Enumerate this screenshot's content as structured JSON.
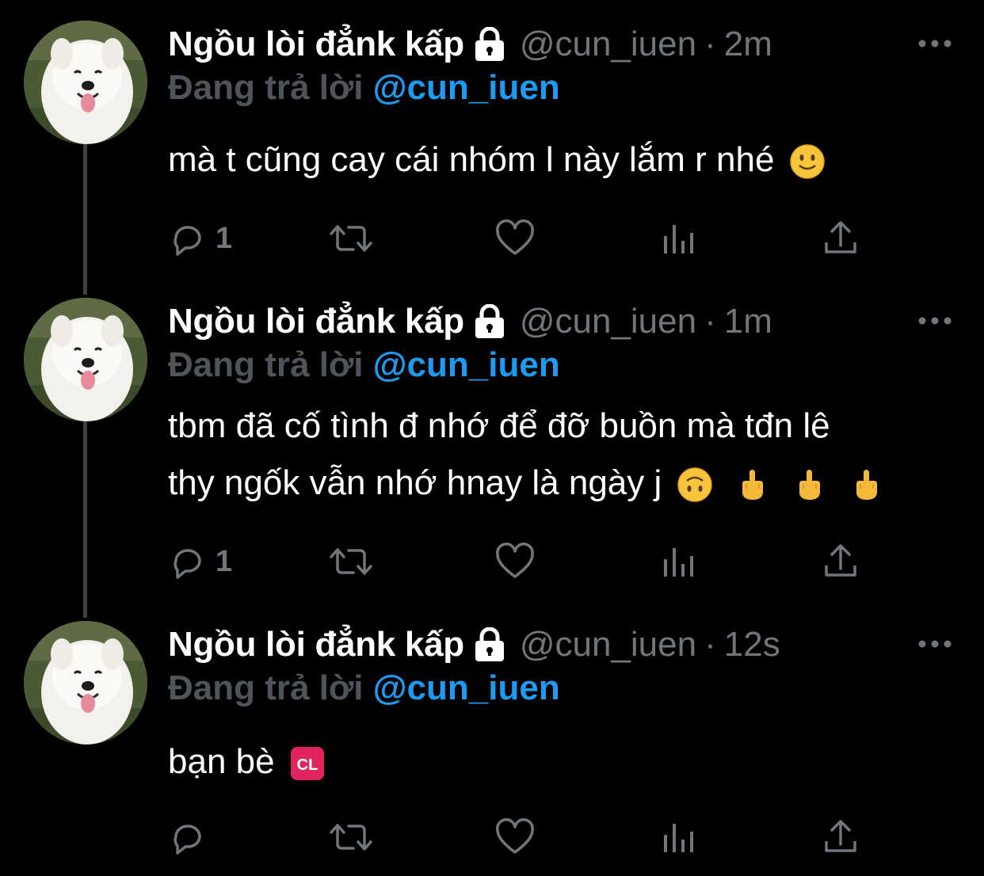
{
  "tweets": [
    {
      "name": "Ngồu lòi đẳnk kấp",
      "handle": "@cun_iuen",
      "separator": "·",
      "time": "2m",
      "reply_prefix": "Đang trả lời",
      "reply_mention": "@cun_iuen",
      "lines": [
        "mà t cũng cay cái nhóm l này lắm r nhé"
      ],
      "reply_count": "1"
    },
    {
      "name": "Ngồu lòi đẳnk kấp",
      "handle": "@cun_iuen",
      "separator": "·",
      "time": "1m",
      "reply_prefix": "Đang trả lời",
      "reply_mention": "@cun_iuen",
      "lines": [
        "tbm đã cố tình đ nhớ để đỡ buồn mà tđn lê",
        "thy ngốk vẫn nhớ hnay là ngày j"
      ],
      "reply_count": "1"
    },
    {
      "name": "Ngồu lòi đẳnk kấp",
      "handle": "@cun_iuen",
      "separator": "·",
      "time": "12s",
      "reply_prefix": "Đang trả lời",
      "reply_mention": "@cun_iuen",
      "lines": [
        "bạn bè"
      ],
      "reply_count": ""
    }
  ],
  "emoji": {
    "cl_label": "CL"
  },
  "colors": {
    "background": "#000000",
    "name": "#ffffff",
    "muted": "#71767b",
    "reply_prefix": "#4e545a",
    "mention": "#1d9bf0",
    "thread_line": "#3d4145"
  },
  "icons": [
    "lock-icon",
    "more-icon",
    "reply-icon",
    "retweet-icon",
    "like-icon",
    "views-icon",
    "share-icon",
    "slightly-smiling-face-emoji",
    "upside-down-face-emoji",
    "middle-finger-emoji",
    "cl-button-emoji"
  ]
}
